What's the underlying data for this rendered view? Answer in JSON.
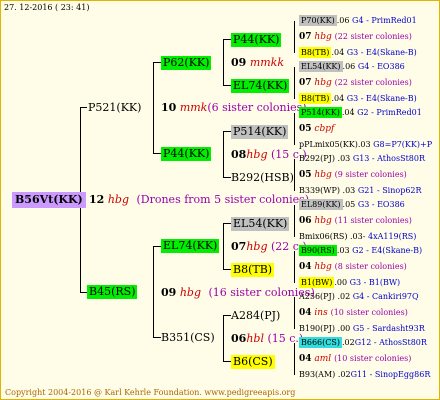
{
  "header": {
    "date": "27. 12-2016 ( 23: 41)"
  },
  "footer": {
    "copyright": "Copyright 2004-2016 @ Karl Kehrle Foundation.   www.pedigreeapis.org"
  },
  "root": {
    "id": "B56Vt(KK)"
  },
  "gen1": {
    "num": "12",
    "race": "hbg",
    "note": "(Drones from 5 sister colonies)",
    "top": "P521(KK)",
    "bottom": "B45(RS)"
  },
  "gen2": {
    "a": {
      "num": "10",
      "race": "mmk",
      "note": "(6 sister colonies)",
      "top": "P62(KK)",
      "bottom": "P44(KK)"
    },
    "b": {
      "num": "09",
      "race": "hbg",
      "note": "(16 sister colonies)",
      "top": "EL74(KK)",
      "bottom": "B351(CS)"
    }
  },
  "gen3": {
    "a": {
      "num": "09",
      "race": "mmkk",
      "top": "P44(KK)",
      "bottom": "EL74(KK)"
    },
    "b": {
      "num": "08",
      "race": "hbg",
      "note": "(15 c.)",
      "top": "P514(KK)",
      "bottom": "B292(HSB)"
    },
    "c": {
      "num": "07",
      "race": "hbg",
      "note": "(22 c.)",
      "top": "EL54(KK)",
      "bottom": "B8(TB)"
    },
    "d": {
      "num": "06",
      "race": "hbl",
      "note": "(15 c.)",
      "top": "A284(PJ)",
      "bottom": "B6(CS)"
    }
  },
  "gen4": [
    {
      "top": "P70(KK)",
      "top_code": ".06",
      "top_info": "G4 - PrimRed01",
      "num": "07",
      "race": "hbg",
      "note": "(22 sister colonies)",
      "bottom": "B8(TB)",
      "bottom_code": ".04",
      "bottom_info": "G3 - E4(Skane-B)"
    },
    {
      "top": "EL54(KK)",
      "top_code": ".06",
      "top_info": "G4 - EO386",
      "num": "07",
      "race": "hbg",
      "note": "(22 sister colonies)",
      "bottom": "B8(TB)",
      "bottom_code": ".04",
      "bottom_info": "G3 - E4(Skane-B)"
    },
    {
      "top": "P514(KK)",
      "top_code": ".04",
      "top_info": "G2 - PrimRed01",
      "num": "05",
      "race": "cbpf",
      "note": "",
      "bottom": "pPLmix05(KK)",
      "bottom_code": ".03",
      "bottom_info": "G8=P7(KK)+P"
    },
    {
      "top": "B292(PJ)",
      "top_code": ".03",
      "top_info": "G13 - AthosSt80R",
      "num": "05",
      "race": "hbg",
      "note": "(9 sister colonies)",
      "bottom": "B339(WP)",
      "bottom_code": ".03",
      "bottom_info": "G21 - Sinop62R"
    },
    {
      "top": "EL89(KK)",
      "top_code": ".05",
      "top_info": "G3 - EO386",
      "num": "06",
      "race": "hbg",
      "note": "(11 sister colonies)",
      "bottom": "Bmix06(RS)",
      "bottom_code": ".03",
      "bottom_info": "- 4xA119(RS)"
    },
    {
      "top": "B90(RS)",
      "top_code": ".03",
      "top_info": "G2 - E4(Skane-B)",
      "num": "04",
      "race": "hbg",
      "note": "(8 sister colonies)",
      "bottom": "B1(BW)",
      "bottom_code": ".00",
      "bottom_info": "G3 - B1(BW)"
    },
    {
      "top": "A256(PJ)",
      "top_code": ".02",
      "top_info": "G4 - Cankiri97Q",
      "num": "04",
      "race": "ins",
      "note": "(10 sister colonies)",
      "bottom": "B190(PJ)",
      "bottom_code": ".00",
      "bottom_info": "G5 - Sardasht93R"
    },
    {
      "top": "B666(CS)",
      "top_code": ".02",
      "top_info": "G12 - AthosSt80R",
      "num": "04",
      "race": "aml",
      "note": "(10 sister colonies)",
      "bottom": "B93(AM)",
      "bottom_code": ".02",
      "bottom_info": "G11 - SinopEgg86R"
    }
  ]
}
